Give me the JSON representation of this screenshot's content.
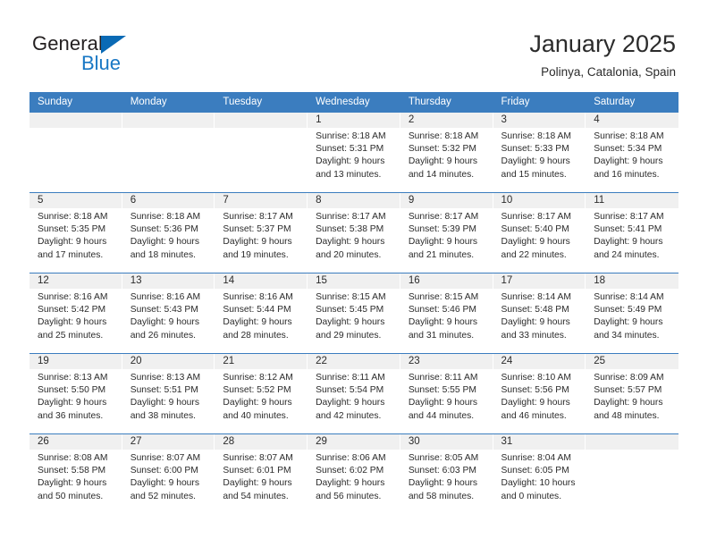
{
  "brand": {
    "name_part1": "General",
    "name_part2": "Blue",
    "accent_color": "#1877c4",
    "triangle_color": "#0a6ab5"
  },
  "header": {
    "title": "January 2025",
    "subtitle": "Polinya, Catalonia, Spain"
  },
  "calendar": {
    "header_bg": "#3b7dbf",
    "date_band_bg": "#f0f0f0",
    "weekdays": [
      "Sunday",
      "Monday",
      "Tuesday",
      "Wednesday",
      "Thursday",
      "Friday",
      "Saturday"
    ],
    "weeks": [
      [
        {
          "day": "",
          "lines": []
        },
        {
          "day": "",
          "lines": []
        },
        {
          "day": "",
          "lines": []
        },
        {
          "day": "1",
          "lines": [
            "Sunrise: 8:18 AM",
            "Sunset: 5:31 PM",
            "Daylight: 9 hours",
            "and 13 minutes."
          ]
        },
        {
          "day": "2",
          "lines": [
            "Sunrise: 8:18 AM",
            "Sunset: 5:32 PM",
            "Daylight: 9 hours",
            "and 14 minutes."
          ]
        },
        {
          "day": "3",
          "lines": [
            "Sunrise: 8:18 AM",
            "Sunset: 5:33 PM",
            "Daylight: 9 hours",
            "and 15 minutes."
          ]
        },
        {
          "day": "4",
          "lines": [
            "Sunrise: 8:18 AM",
            "Sunset: 5:34 PM",
            "Daylight: 9 hours",
            "and 16 minutes."
          ]
        }
      ],
      [
        {
          "day": "5",
          "lines": [
            "Sunrise: 8:18 AM",
            "Sunset: 5:35 PM",
            "Daylight: 9 hours",
            "and 17 minutes."
          ]
        },
        {
          "day": "6",
          "lines": [
            "Sunrise: 8:18 AM",
            "Sunset: 5:36 PM",
            "Daylight: 9 hours",
            "and 18 minutes."
          ]
        },
        {
          "day": "7",
          "lines": [
            "Sunrise: 8:17 AM",
            "Sunset: 5:37 PM",
            "Daylight: 9 hours",
            "and 19 minutes."
          ]
        },
        {
          "day": "8",
          "lines": [
            "Sunrise: 8:17 AM",
            "Sunset: 5:38 PM",
            "Daylight: 9 hours",
            "and 20 minutes."
          ]
        },
        {
          "day": "9",
          "lines": [
            "Sunrise: 8:17 AM",
            "Sunset: 5:39 PM",
            "Daylight: 9 hours",
            "and 21 minutes."
          ]
        },
        {
          "day": "10",
          "lines": [
            "Sunrise: 8:17 AM",
            "Sunset: 5:40 PM",
            "Daylight: 9 hours",
            "and 22 minutes."
          ]
        },
        {
          "day": "11",
          "lines": [
            "Sunrise: 8:17 AM",
            "Sunset: 5:41 PM",
            "Daylight: 9 hours",
            "and 24 minutes."
          ]
        }
      ],
      [
        {
          "day": "12",
          "lines": [
            "Sunrise: 8:16 AM",
            "Sunset: 5:42 PM",
            "Daylight: 9 hours",
            "and 25 minutes."
          ]
        },
        {
          "day": "13",
          "lines": [
            "Sunrise: 8:16 AM",
            "Sunset: 5:43 PM",
            "Daylight: 9 hours",
            "and 26 minutes."
          ]
        },
        {
          "day": "14",
          "lines": [
            "Sunrise: 8:16 AM",
            "Sunset: 5:44 PM",
            "Daylight: 9 hours",
            "and 28 minutes."
          ]
        },
        {
          "day": "15",
          "lines": [
            "Sunrise: 8:15 AM",
            "Sunset: 5:45 PM",
            "Daylight: 9 hours",
            "and 29 minutes."
          ]
        },
        {
          "day": "16",
          "lines": [
            "Sunrise: 8:15 AM",
            "Sunset: 5:46 PM",
            "Daylight: 9 hours",
            "and 31 minutes."
          ]
        },
        {
          "day": "17",
          "lines": [
            "Sunrise: 8:14 AM",
            "Sunset: 5:48 PM",
            "Daylight: 9 hours",
            "and 33 minutes."
          ]
        },
        {
          "day": "18",
          "lines": [
            "Sunrise: 8:14 AM",
            "Sunset: 5:49 PM",
            "Daylight: 9 hours",
            "and 34 minutes."
          ]
        }
      ],
      [
        {
          "day": "19",
          "lines": [
            "Sunrise: 8:13 AM",
            "Sunset: 5:50 PM",
            "Daylight: 9 hours",
            "and 36 minutes."
          ]
        },
        {
          "day": "20",
          "lines": [
            "Sunrise: 8:13 AM",
            "Sunset: 5:51 PM",
            "Daylight: 9 hours",
            "and 38 minutes."
          ]
        },
        {
          "day": "21",
          "lines": [
            "Sunrise: 8:12 AM",
            "Sunset: 5:52 PM",
            "Daylight: 9 hours",
            "and 40 minutes."
          ]
        },
        {
          "day": "22",
          "lines": [
            "Sunrise: 8:11 AM",
            "Sunset: 5:54 PM",
            "Daylight: 9 hours",
            "and 42 minutes."
          ]
        },
        {
          "day": "23",
          "lines": [
            "Sunrise: 8:11 AM",
            "Sunset: 5:55 PM",
            "Daylight: 9 hours",
            "and 44 minutes."
          ]
        },
        {
          "day": "24",
          "lines": [
            "Sunrise: 8:10 AM",
            "Sunset: 5:56 PM",
            "Daylight: 9 hours",
            "and 46 minutes."
          ]
        },
        {
          "day": "25",
          "lines": [
            "Sunrise: 8:09 AM",
            "Sunset: 5:57 PM",
            "Daylight: 9 hours",
            "and 48 minutes."
          ]
        }
      ],
      [
        {
          "day": "26",
          "lines": [
            "Sunrise: 8:08 AM",
            "Sunset: 5:58 PM",
            "Daylight: 9 hours",
            "and 50 minutes."
          ]
        },
        {
          "day": "27",
          "lines": [
            "Sunrise: 8:07 AM",
            "Sunset: 6:00 PM",
            "Daylight: 9 hours",
            "and 52 minutes."
          ]
        },
        {
          "day": "28",
          "lines": [
            "Sunrise: 8:07 AM",
            "Sunset: 6:01 PM",
            "Daylight: 9 hours",
            "and 54 minutes."
          ]
        },
        {
          "day": "29",
          "lines": [
            "Sunrise: 8:06 AM",
            "Sunset: 6:02 PM",
            "Daylight: 9 hours",
            "and 56 minutes."
          ]
        },
        {
          "day": "30",
          "lines": [
            "Sunrise: 8:05 AM",
            "Sunset: 6:03 PM",
            "Daylight: 9 hours",
            "and 58 minutes."
          ]
        },
        {
          "day": "31",
          "lines": [
            "Sunrise: 8:04 AM",
            "Sunset: 6:05 PM",
            "Daylight: 10 hours",
            "and 0 minutes."
          ]
        },
        {
          "day": "",
          "lines": []
        }
      ]
    ]
  }
}
